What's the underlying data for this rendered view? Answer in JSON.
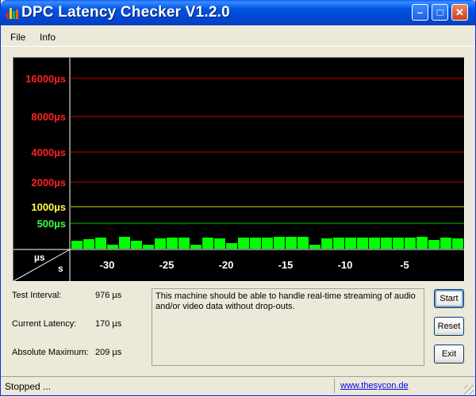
{
  "window": {
    "title": "DPC Latency Checker V1.2.0"
  },
  "menu": {
    "file": "File",
    "info": "Info"
  },
  "graph": {
    "y_labels": [
      {
        "text": "16000µs",
        "color": "#FF2020",
        "line": "#C00000"
      },
      {
        "text": "8000µs",
        "color": "#FF2020",
        "line": "#C00000"
      },
      {
        "text": "4000µs",
        "color": "#FF2020",
        "line": "#C00000"
      },
      {
        "text": "2000µs",
        "color": "#FF2020",
        "line": "#C00000"
      },
      {
        "text": "1000µs",
        "color": "#FFFF40",
        "line": "#E0E000"
      },
      {
        "text": "500µs",
        "color": "#40FF40",
        "line": "#00C000"
      }
    ],
    "corner_top": "µs",
    "corner_bottom": "s",
    "x_labels": [
      "-30",
      "-25",
      "-20",
      "-15",
      "-10",
      "-5"
    ],
    "bar_color": "#00FF00",
    "bar_values": [
      0.55,
      0.65,
      0.8,
      0.3,
      0.85,
      0.55,
      0.3,
      0.7,
      0.8,
      0.8,
      0.3,
      0.8,
      0.7,
      0.4,
      0.75,
      0.75,
      0.75,
      0.85,
      0.85,
      0.85,
      0.3,
      0.7,
      0.8,
      0.75,
      0.8,
      0.8,
      0.8,
      0.8,
      0.8,
      0.85,
      0.6,
      0.75,
      0.7,
      0.8
    ]
  },
  "stats": {
    "test_interval_label": "Test Interval:",
    "test_interval_value": "976 µs",
    "current_latency_label": "Current Latency:",
    "current_latency_value": "170 µs",
    "absolute_maximum_label": "Absolute Maximum:",
    "absolute_maximum_value": "209 µs"
  },
  "message": "This machine should be able to handle real-time streaming of audio and/or video data without drop-outs.",
  "buttons": {
    "start": "Start",
    "reset": "Reset",
    "exit": "Exit"
  },
  "status": {
    "text": "Stopped ...",
    "link": "www.thesycon.de"
  }
}
